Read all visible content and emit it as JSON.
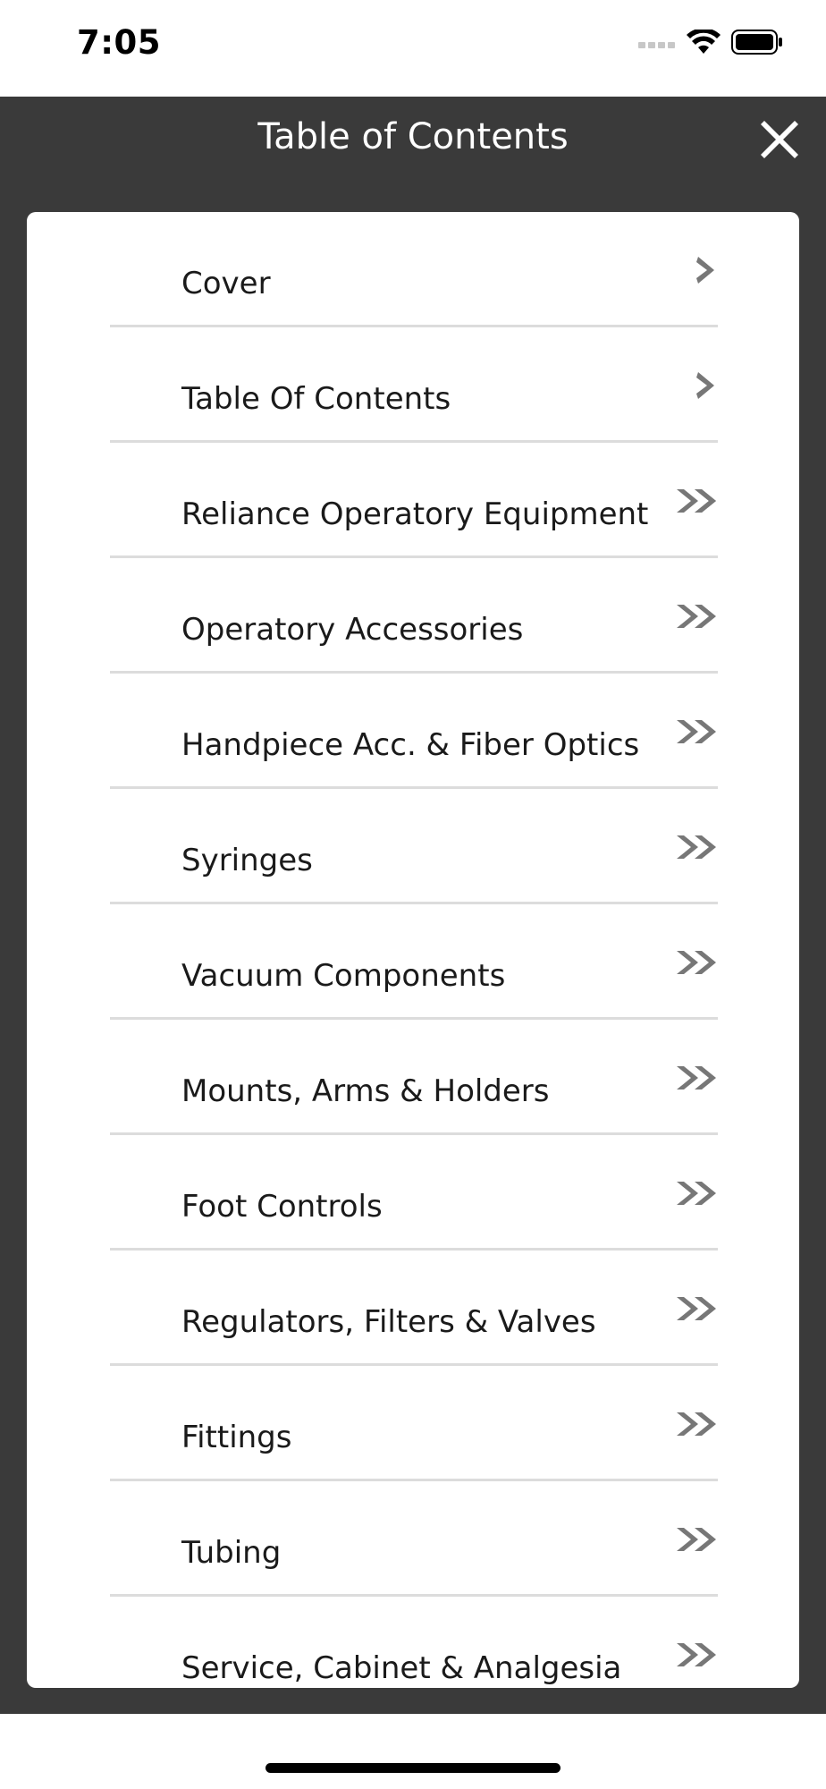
{
  "status_bar": {
    "time": "7:05",
    "icons": [
      "signal-icon",
      "wifi-icon",
      "battery-icon"
    ]
  },
  "header": {
    "title": "Table of Contents",
    "close_icon": "close-icon"
  },
  "toc": {
    "items": [
      {
        "label": "Cover",
        "icon": "chevron-right-icon"
      },
      {
        "label": "Table Of Contents",
        "icon": "chevron-right-icon"
      },
      {
        "label": "Reliance Operatory Equipment",
        "icon": "double-chevron-right-icon"
      },
      {
        "label": "Operatory Accessories",
        "icon": "double-chevron-right-icon"
      },
      {
        "label": "Handpiece Acc. & Fiber Optics",
        "icon": "double-chevron-right-icon"
      },
      {
        "label": "Syringes",
        "icon": "double-chevron-right-icon"
      },
      {
        "label": "Vacuum Components",
        "icon": "double-chevron-right-icon"
      },
      {
        "label": "Mounts, Arms & Holders",
        "icon": "double-chevron-right-icon"
      },
      {
        "label": "Foot Controls",
        "icon": "double-chevron-right-icon"
      },
      {
        "label": "Regulators, Filters & Valves",
        "icon": "double-chevron-right-icon"
      },
      {
        "label": "Fittings",
        "icon": "double-chevron-right-icon"
      },
      {
        "label": "Tubing",
        "icon": "double-chevron-right-icon"
      },
      {
        "label": "Service, Cabinet & Analgesia",
        "icon": "double-chevron-right-icon"
      }
    ]
  },
  "colors": {
    "header_bg": "#3a3a3a",
    "panel_bg": "#ffffff",
    "divider": "#dcdcdc",
    "chevron": "#777777"
  }
}
